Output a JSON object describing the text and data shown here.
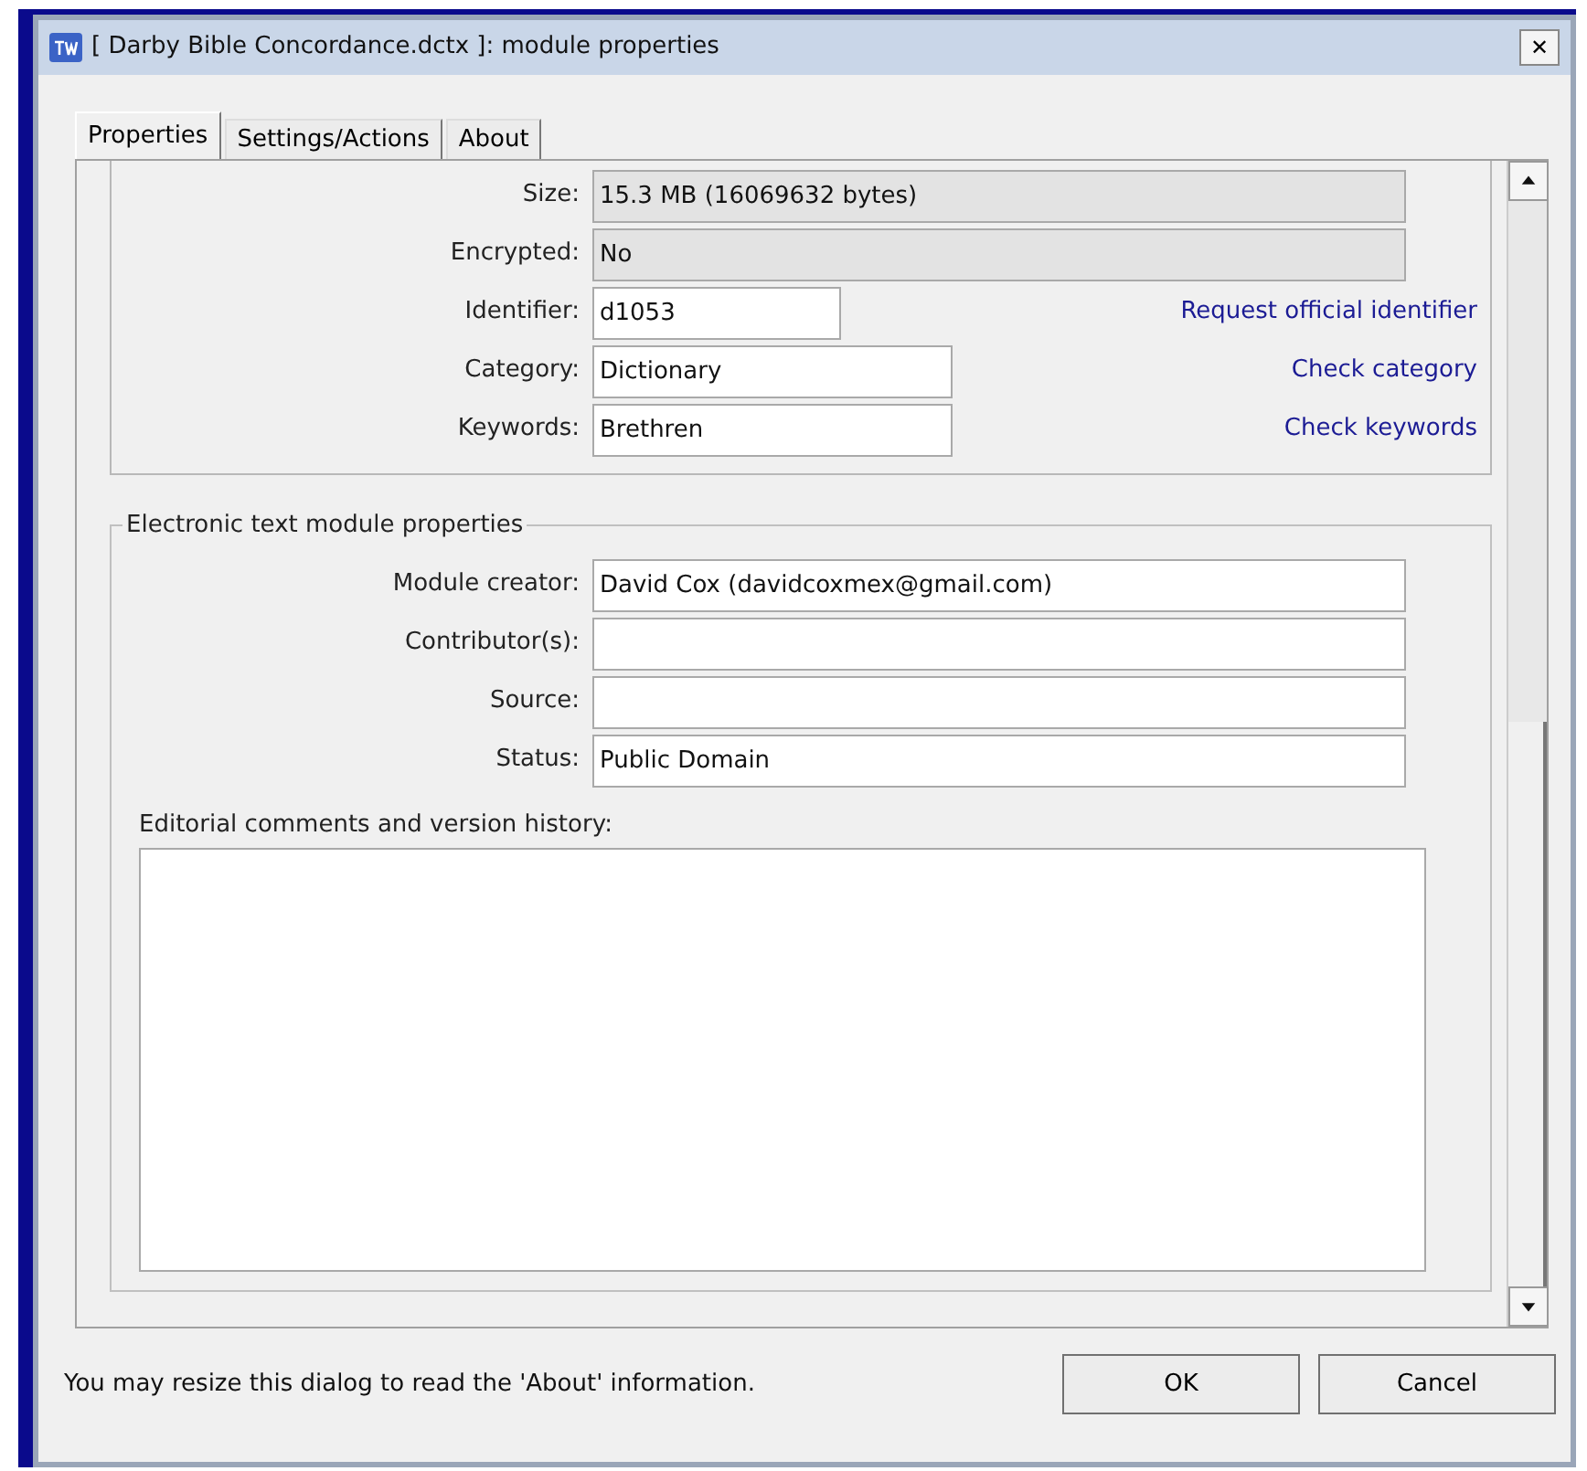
{
  "window": {
    "title": "[ Darby Bible Concordance.dctx ]: module properties",
    "close": "✕"
  },
  "tabs": [
    {
      "label": "Properties",
      "selected": true
    },
    {
      "label": "Settings/Actions",
      "selected": false
    },
    {
      "label": "About",
      "selected": false
    }
  ],
  "file_properties": [
    {
      "label": "Size:",
      "value": "15.3 MB (16069632 bytes)",
      "kind": "readonly"
    },
    {
      "label": "Encrypted:",
      "value": "No",
      "kind": "readonly"
    },
    {
      "label": "Identifier:",
      "value": "d1053",
      "kind": "short",
      "link": "Request official identifier"
    },
    {
      "label": "Category:",
      "value": "Dictionary",
      "kind": "medium",
      "link": "Check category"
    },
    {
      "label": "Keywords:",
      "value": "Brethren",
      "kind": "medium",
      "link": "Check keywords"
    }
  ],
  "electronic_text": {
    "legend": "Electronic text module properties",
    "fields": [
      {
        "label": "Module creator:",
        "value": "David Cox (davidcoxmex@gmail.com)"
      },
      {
        "label": "Contributor(s):"
      },
      {
        "label": "Source:"
      },
      {
        "label": "Status:",
        "value": "Public Domain"
      }
    ],
    "comments_label": "Editorial comments and version history:"
  },
  "footer_note": "You may resize this dialog to read the 'About' information.",
  "buttons": [
    "OK",
    "Cancel"
  ]
}
